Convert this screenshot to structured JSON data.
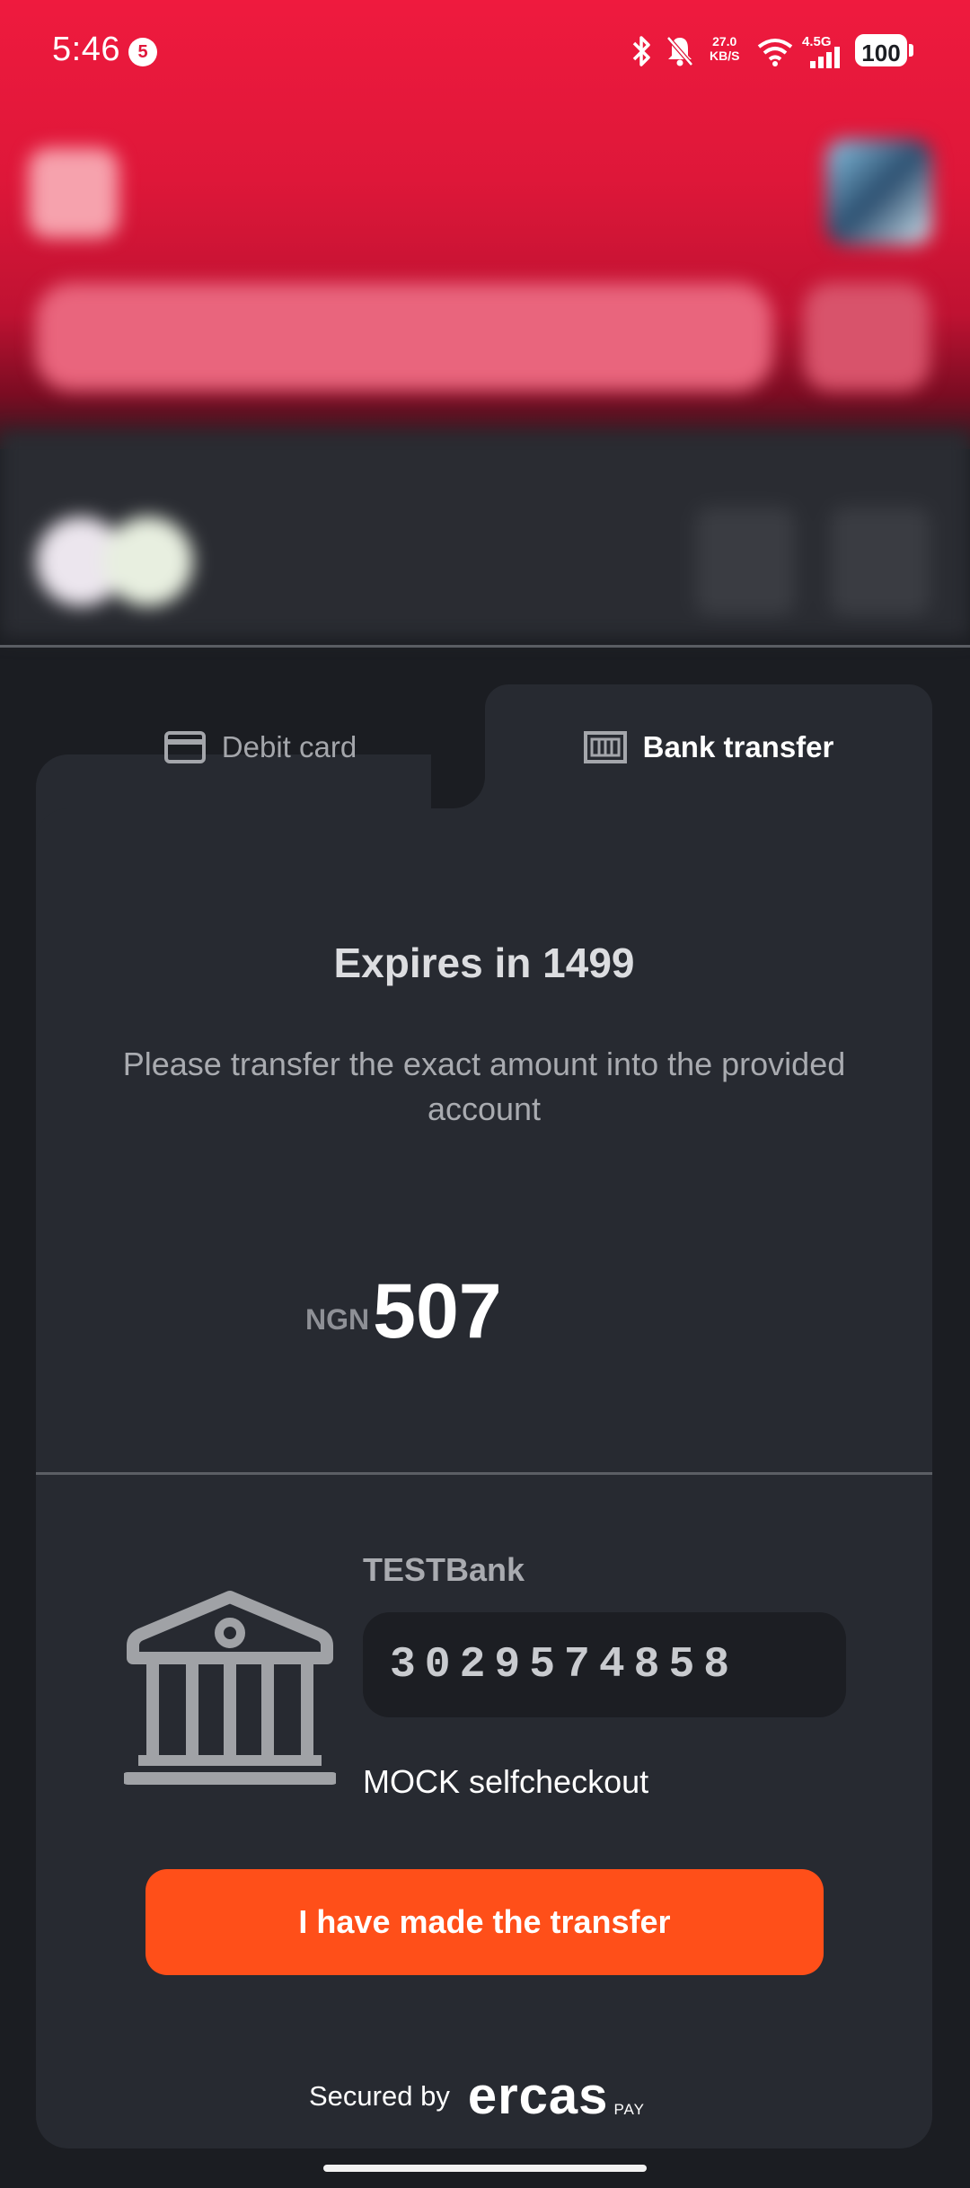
{
  "status_bar": {
    "time": "5:46",
    "notification_count": "5",
    "net_speed_value": "27.0",
    "net_speed_unit": "KB/S",
    "network_type": "4.5G",
    "battery": "100"
  },
  "tabs": [
    {
      "label": "Debit card",
      "icon": "credit-card-icon",
      "active": false
    },
    {
      "label": "Bank transfer",
      "icon": "bank-transfer-icon",
      "active": true
    }
  ],
  "transfer": {
    "expires_text": "Expires in 1499",
    "instructions": "Please transfer the exact amount into the provided account",
    "currency": "NGN",
    "amount": "507",
    "bank_name": "TESTBank",
    "account_number": "3029574858",
    "account_holder": "MOCK selfcheckout",
    "confirm_button": "I have made the transfer"
  },
  "footer": {
    "secured_by": "Secured by",
    "brand": "ercas",
    "brand_sub": "PAY"
  },
  "colors": {
    "accent": "#ff4f19",
    "header_red": "#ef1a3e",
    "card_bg": "#272a31",
    "page_bg": "#1b1d22"
  }
}
